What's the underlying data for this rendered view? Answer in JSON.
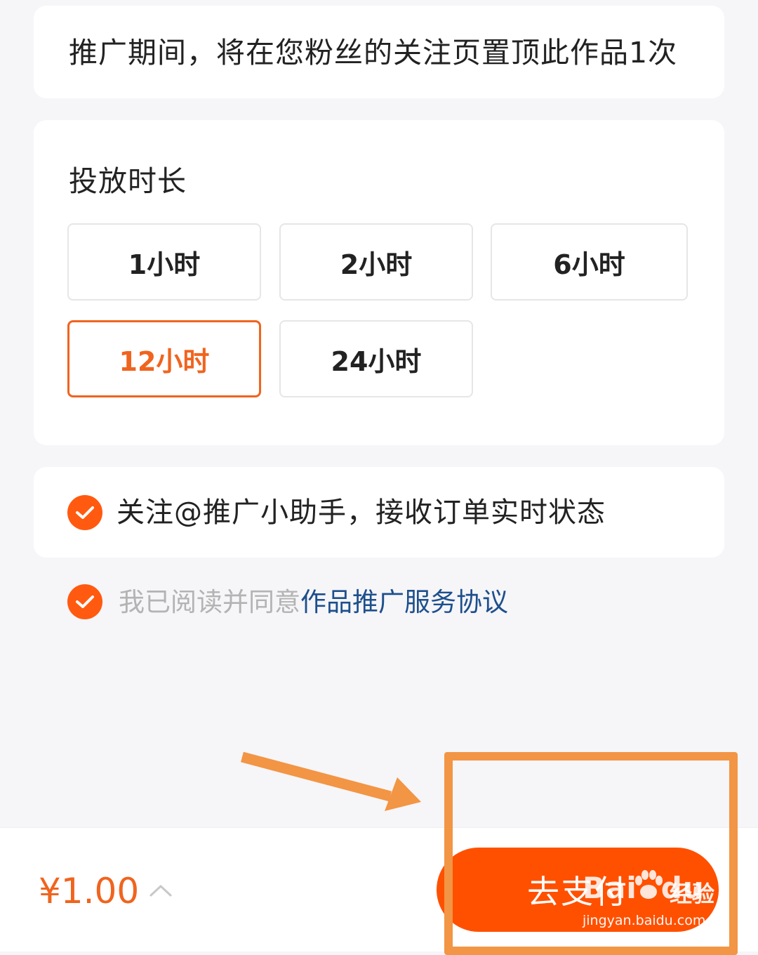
{
  "notice": {
    "text": "推广期间，将在您粉丝的关注页置顶此作品1次"
  },
  "duration": {
    "title": "投放时长",
    "options": [
      {
        "label": "1小时",
        "selected": false
      },
      {
        "label": "2小时",
        "selected": false
      },
      {
        "label": "6小时",
        "selected": false
      },
      {
        "label": "12小时",
        "selected": true
      },
      {
        "label": "24小时",
        "selected": false
      }
    ]
  },
  "follow": {
    "checked": true,
    "label": "关注@推广小助手，接收订单实时状态"
  },
  "agreement": {
    "checked": true,
    "prefix": "我已阅读并同意",
    "link": "作品推广服务协议"
  },
  "bottom": {
    "price": "¥1.00",
    "pay_label": "去支付"
  },
  "annotation": {
    "color": "#f29544"
  },
  "watermark": {
    "logo": "Bai",
    "logo_suffix": "du",
    "cn": "经验",
    "url": "jingyan.baidu.com"
  },
  "colors": {
    "accent": "#f0641e",
    "button": "#ff5000",
    "link": "#1d4f8c"
  }
}
